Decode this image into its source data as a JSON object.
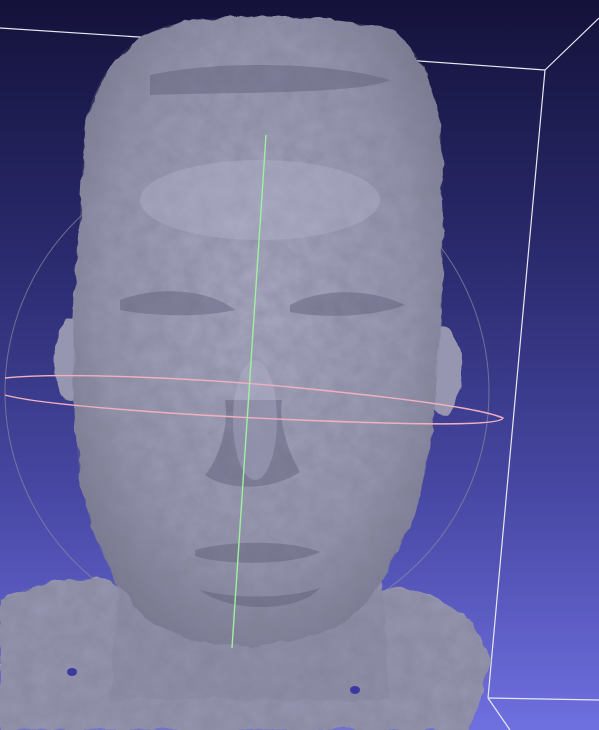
{
  "viewer": {
    "background_top": "#14123a",
    "background_bottom": "#6f70e0",
    "bounding_box_color": "#e8e8f0",
    "trackball_horizontal_color": "#f0b0c0",
    "trackball_vertical_color": "#a0f0a0",
    "trackball_sphere_color": "#9090a8",
    "mesh_color": "#9b9bb3",
    "mesh_shadow_color": "#5e5e78"
  }
}
